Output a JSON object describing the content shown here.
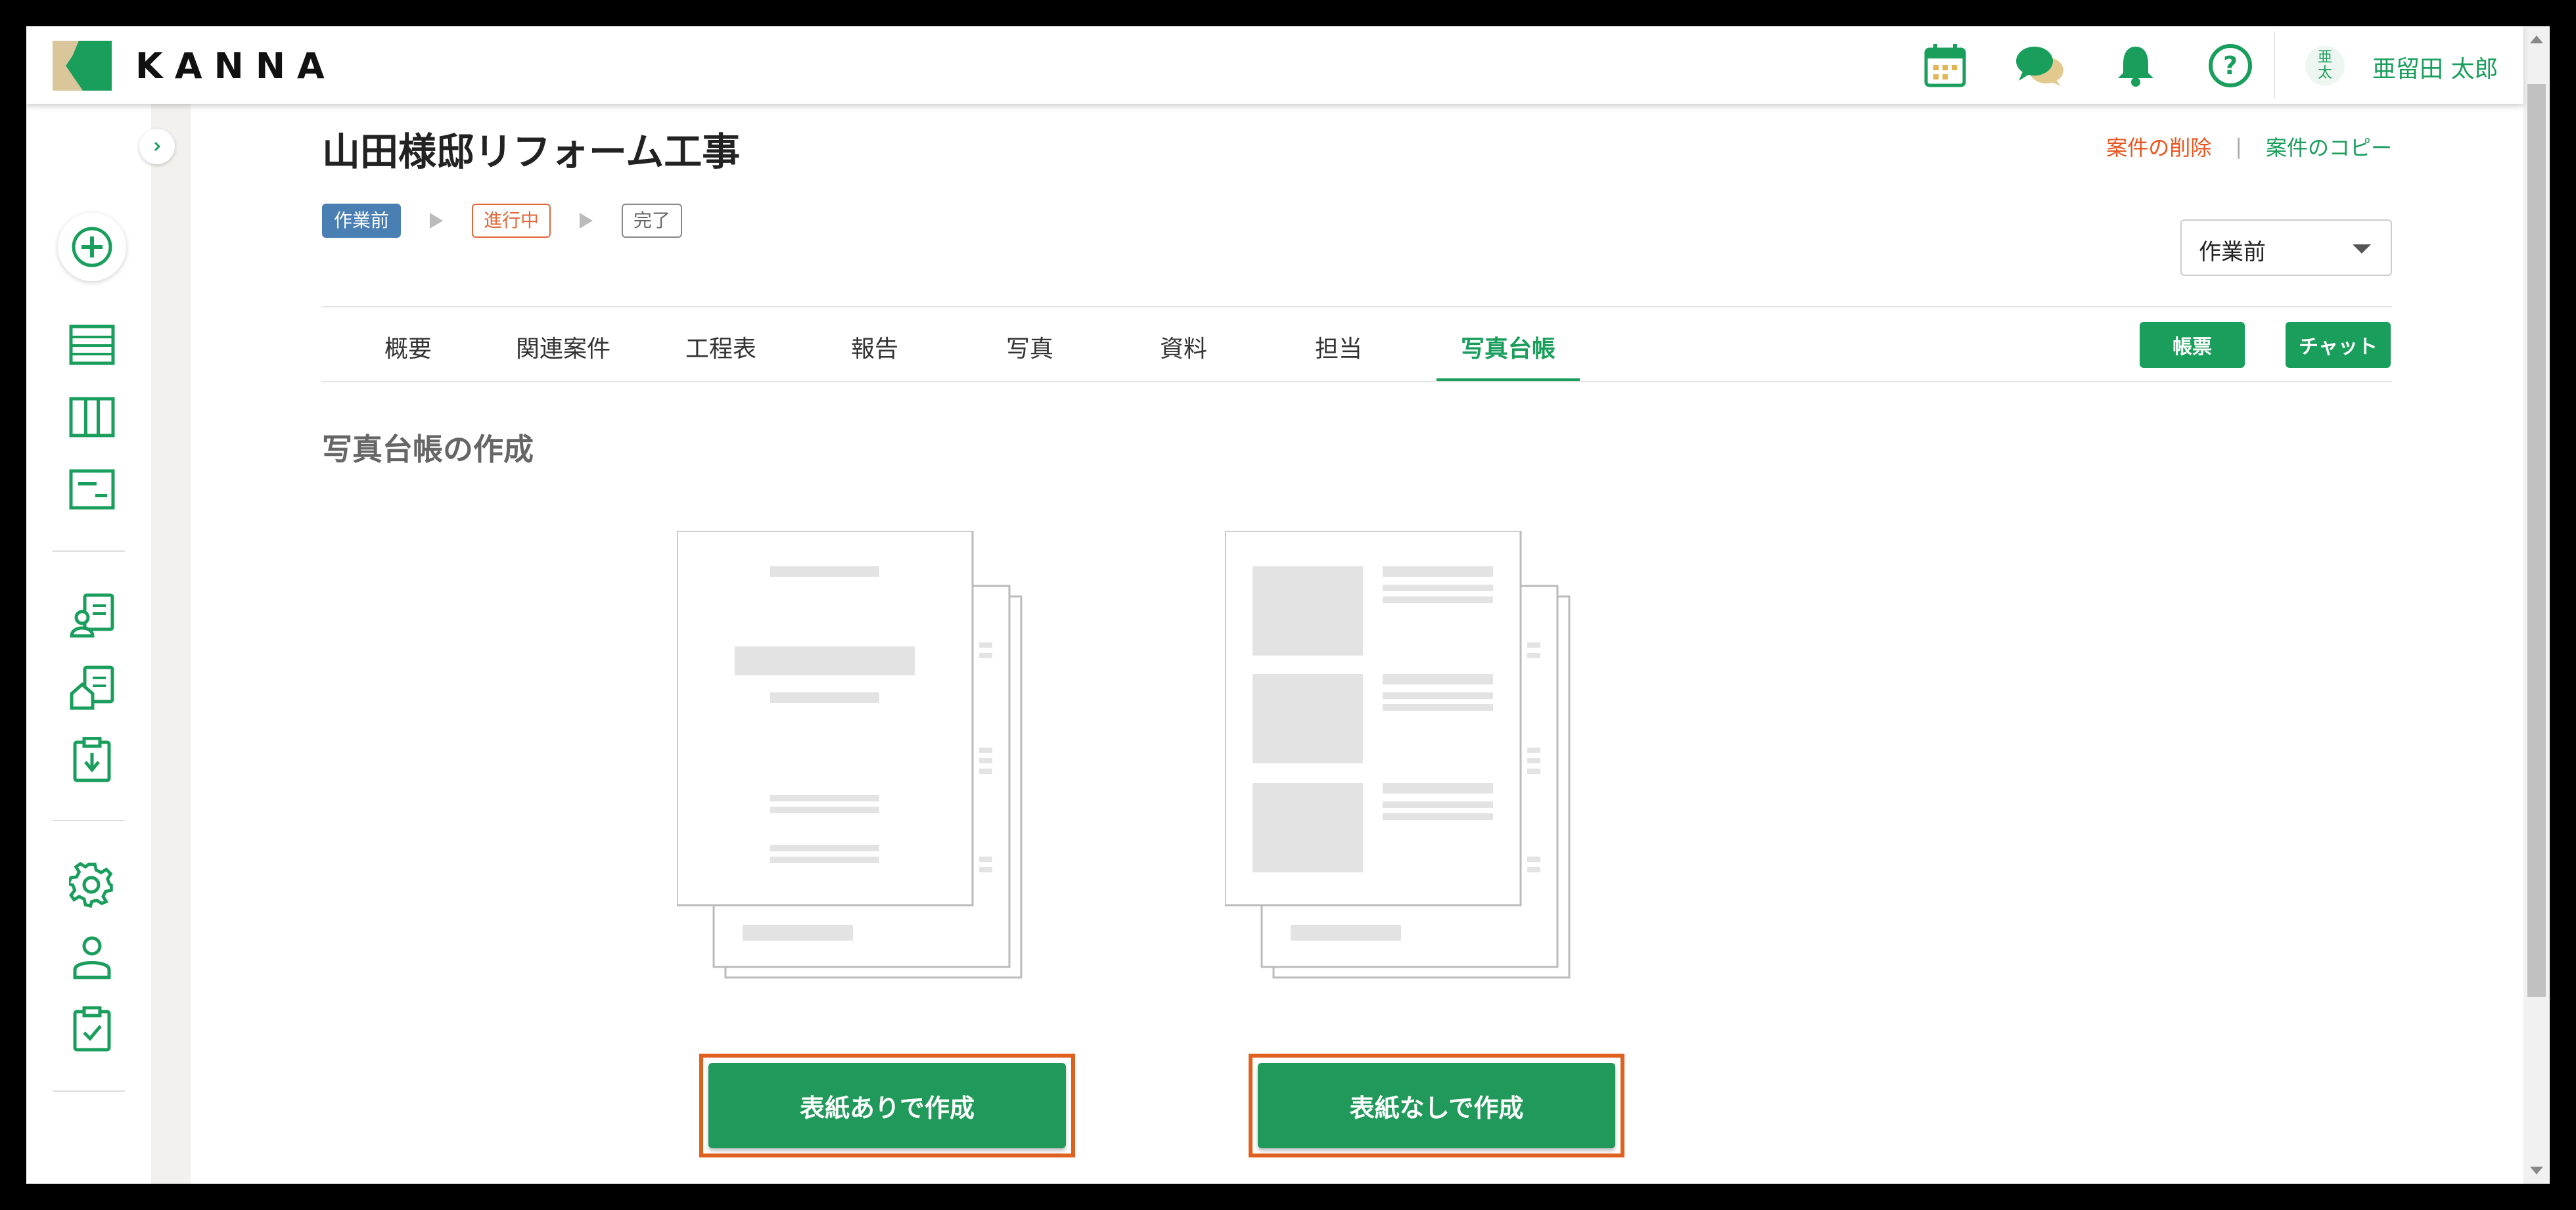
{
  "app": {
    "name": "KANNA"
  },
  "header": {
    "icons": [
      "calendar-icon",
      "chat-icon",
      "bell-icon",
      "help-icon"
    ],
    "user": {
      "avatar_top": "亜",
      "avatar_bottom": "太",
      "name": "亜留田 太郎"
    }
  },
  "sidebar": {
    "icons": [
      "add-icon",
      "list-icon",
      "board-icon",
      "gantt-icon",
      "client-icon",
      "property-icon",
      "download-icon",
      "settings-icon",
      "user-icon",
      "task-icon"
    ]
  },
  "project": {
    "title": "山田様邸リフォーム工事",
    "delete_label": "案件の削除",
    "separator": "|",
    "copy_label": "案件のコピー",
    "steps": [
      "作業前",
      "進行中",
      "完了"
    ],
    "current_status": "作業前"
  },
  "tabs": [
    "概要",
    "関連案件",
    "工程表",
    "報告",
    "写真",
    "資料",
    "担当",
    "写真台帳"
  ],
  "active_tab": "写真台帳",
  "actions": {
    "form_label": "帳票",
    "chat_label": "チャット"
  },
  "section": {
    "title": "写真台帳の作成"
  },
  "options": [
    {
      "button_label": "表紙ありで作成"
    },
    {
      "button_label": "表紙なしで作成"
    }
  ],
  "colors": {
    "brand": "#1a9e5c",
    "highlight": "#e0611e",
    "delete": "#e8541e",
    "status_active": "#4a7fb4",
    "status_progress": "#e0683a"
  }
}
